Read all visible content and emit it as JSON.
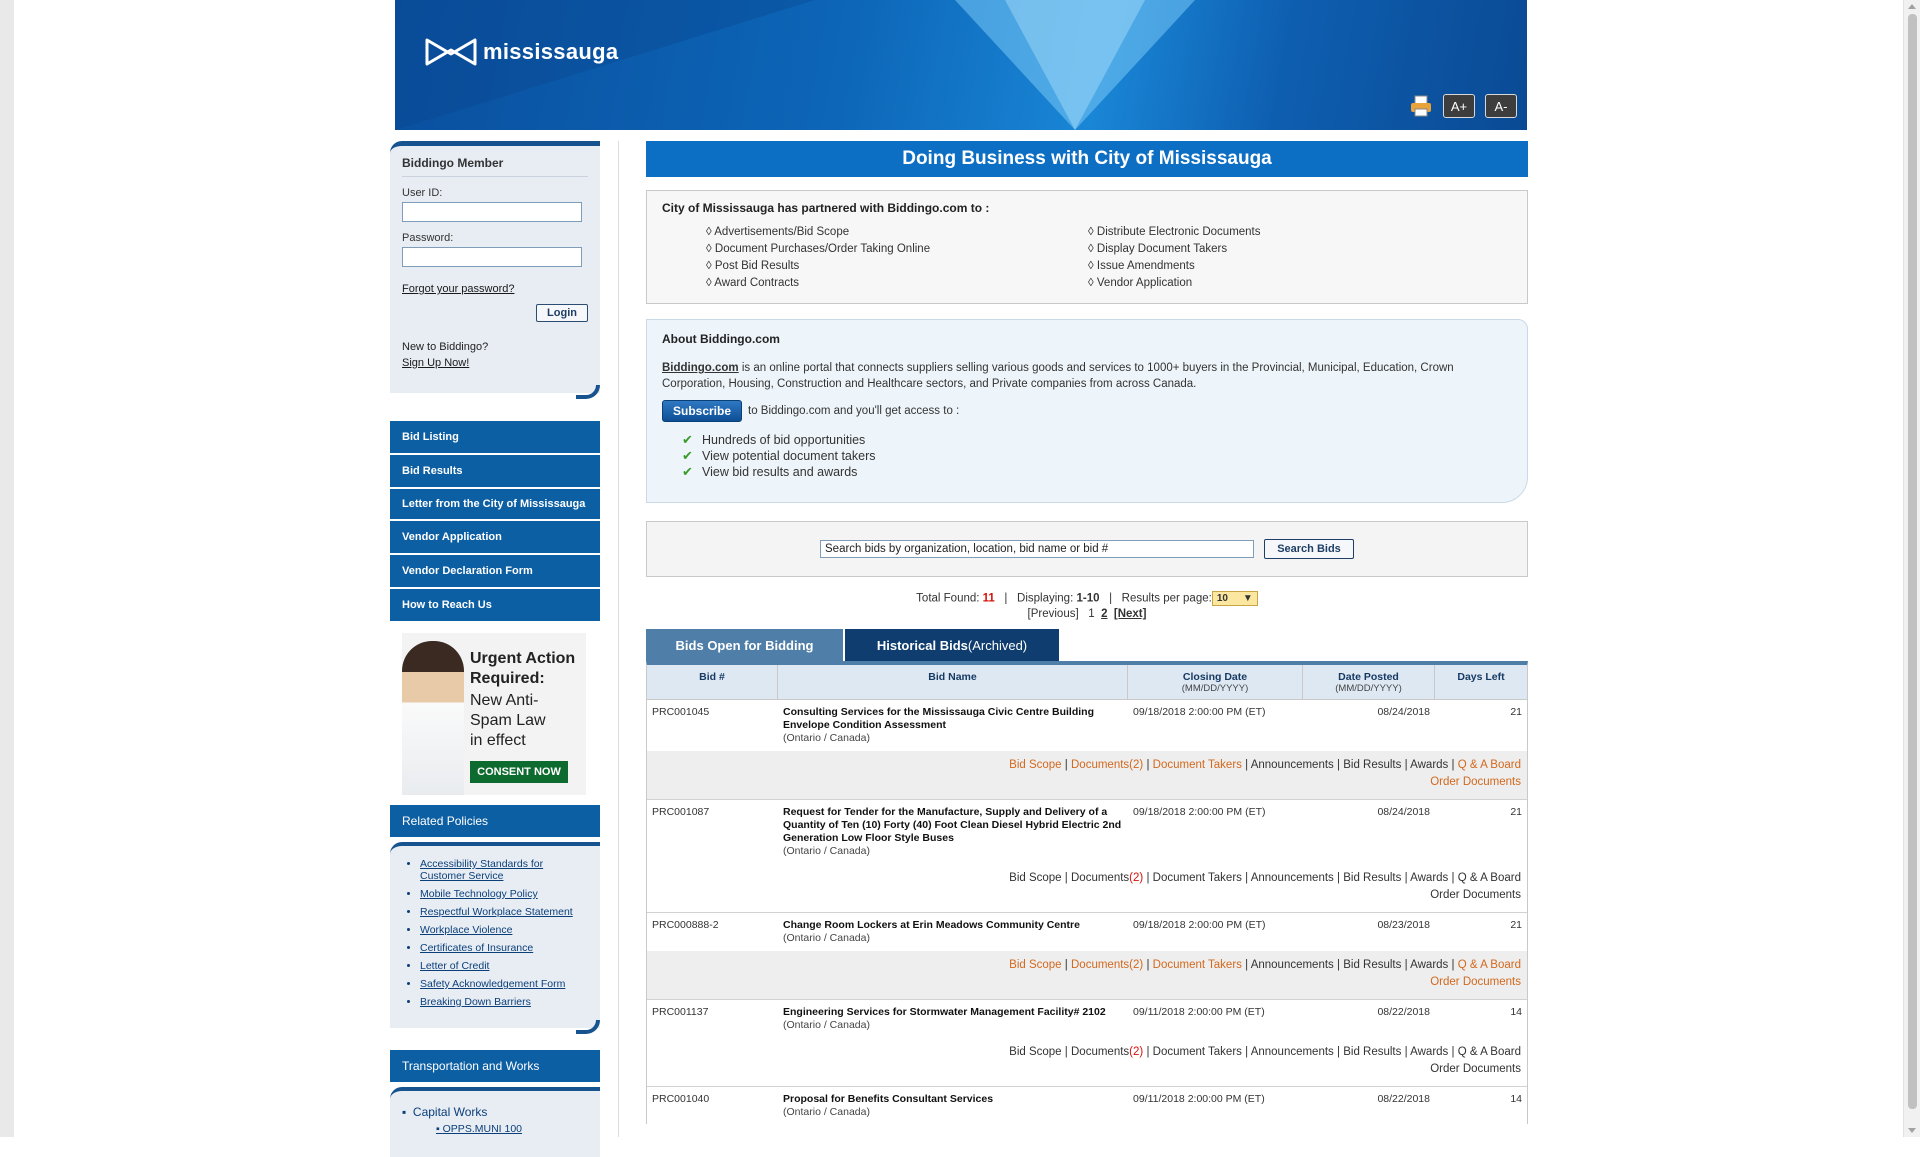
{
  "banner": {
    "logo_text": "mississauga",
    "font_increase_label": "A+",
    "font_decrease_label": "A-"
  },
  "login": {
    "title": "Biddingo Member",
    "user_label": "User ID:",
    "password_label": "Password:",
    "forgot_label": "Forgot your password?",
    "login_button": "Login",
    "new_label": "New to Biddingo?",
    "signup_label": "Sign Up Now!"
  },
  "nav": {
    "items": [
      {
        "label": "Bid Listing"
      },
      {
        "label": "Bid Results"
      },
      {
        "label": "Letter from the City of Mississauga"
      },
      {
        "label": "Vendor Application"
      },
      {
        "label": "Vendor Declaration Form"
      },
      {
        "label": "How to Reach Us"
      }
    ]
  },
  "ad": {
    "title_line1": "Urgent Action",
    "title_line2": "Required:",
    "sub_line1": "New Anti-",
    "sub_line2": "Spam Law",
    "sub_line3": "in effect",
    "button": "CONSENT NOW"
  },
  "related_policies": {
    "title": "Related Policies",
    "items": [
      "Accessibility Standards for Customer Service",
      "Mobile Technology Policy",
      "Respectful Workplace Statement",
      "Workplace Violence",
      "Certificates of Insurance",
      "Letter of Credit",
      "Safety Acknowledgement Form",
      "Breaking Down Barriers"
    ]
  },
  "transportation": {
    "title": "Transportation and Works",
    "item": "Capital Works",
    "sub_item": "OPPS.MUNI 100"
  },
  "main": {
    "title": "Doing Business with City of Mississauga",
    "partner_title": "City of Mississauga has partnered with Biddingo.com to :",
    "partner_left": [
      "Advertisements/Bid Scope",
      "Document Purchases/Order Taking Online",
      "Post Bid Results",
      "Award Contracts"
    ],
    "partner_right": [
      "Distribute Electronic Documents",
      "Display Document Takers",
      "Issue Amendments",
      "Vendor Application"
    ],
    "about_title": "About Biddingo.com",
    "about_link": "Biddingo.com",
    "about_text": " is an online portal that connects suppliers selling various goods and services to 1000+ buyers in the Provincial, Municipal, Education, Crown Corporation, Housing, Construction and Healthcare sectors, and Private companies from across Canada.",
    "subscribe_button": "Subscribe",
    "subscribe_text": "to Biddingo.com and you'll get access to :",
    "benefits": [
      "Hundreds of bid opportunities",
      "View potential document takers",
      "View bid results and awards"
    ],
    "search_placeholder": "Search bids by organization, location, bid name or bid #",
    "search_button": "Search Bids",
    "total_label": "Total Found:",
    "total_value": "11",
    "displaying_label": "Displaying:",
    "displaying_value": "1-10",
    "per_page_label": "Results per page:",
    "per_page_value": "10",
    "prev_label": "[Previous]",
    "page1": "1",
    "page2": "2",
    "next_label": "[Next]",
    "tab_open": "Bids Open for Bidding",
    "tab_hist_a": "Historical Bids",
    "tab_hist_b": " (Archived)"
  },
  "table": {
    "headers": {
      "bid_no": "Bid #",
      "bid_name": "Bid Name",
      "closing": "Closing Date",
      "closing_fmt": "(MM/DD/YYYY)",
      "posted": "Date Posted",
      "posted_fmt": "(MM/DD/YYYY)",
      "days_left": "Days Left"
    },
    "action_labels": {
      "bid_scope": "Bid Scope",
      "documents": "Documents",
      "takers": "Document Takers",
      "announcements": "Announcements",
      "results": "Bid Results",
      "awards": "Awards",
      "qa": "Q & A Board",
      "order": "Order Documents"
    },
    "rows": [
      {
        "id": "PRC001045",
        "name": "Consulting Services for the Mississauga Civic Centre Building Envelope Condition Assessment",
        "location": "(Ontario / Canada)",
        "closing": "09/18/2018 2:00:00 PM (ET)",
        "posted": "08/24/2018",
        "days": "21",
        "doc_count": "(2)"
      },
      {
        "id": "PRC001087",
        "name": "Request for Tender for the Manufacture, Supply and Delivery of a Quantity of Ten (10) Forty (40) Foot Clean Diesel Hybrid Electric 2nd Generation Low Floor Style Buses",
        "location": "(Ontario / Canada)",
        "closing": "09/18/2018 2:00:00 PM (ET)",
        "posted": "08/24/2018",
        "days": "21",
        "doc_count": "(2)"
      },
      {
        "id": "PRC000888-2",
        "name": "Change Room Lockers at Erin Meadows Community Centre",
        "location": "(Ontario / Canada)",
        "closing": "09/18/2018 2:00:00 PM (ET)",
        "posted": "08/23/2018",
        "days": "21",
        "doc_count": "(2)"
      },
      {
        "id": "PRC001137",
        "name": "Engineering Services for Stormwater Management Facility# 2102",
        "location": "(Ontario / Canada)",
        "closing": "09/11/2018 2:00:00 PM (ET)",
        "posted": "08/22/2018",
        "days": "14",
        "doc_count": "(2)"
      },
      {
        "id": "PRC001040",
        "name": "Proposal for Benefits Consultant Services",
        "location": "(Ontario / Canada)",
        "closing": "09/11/2018 2:00:00 PM (ET)",
        "posted": "08/22/2018",
        "days": "14"
      }
    ]
  }
}
